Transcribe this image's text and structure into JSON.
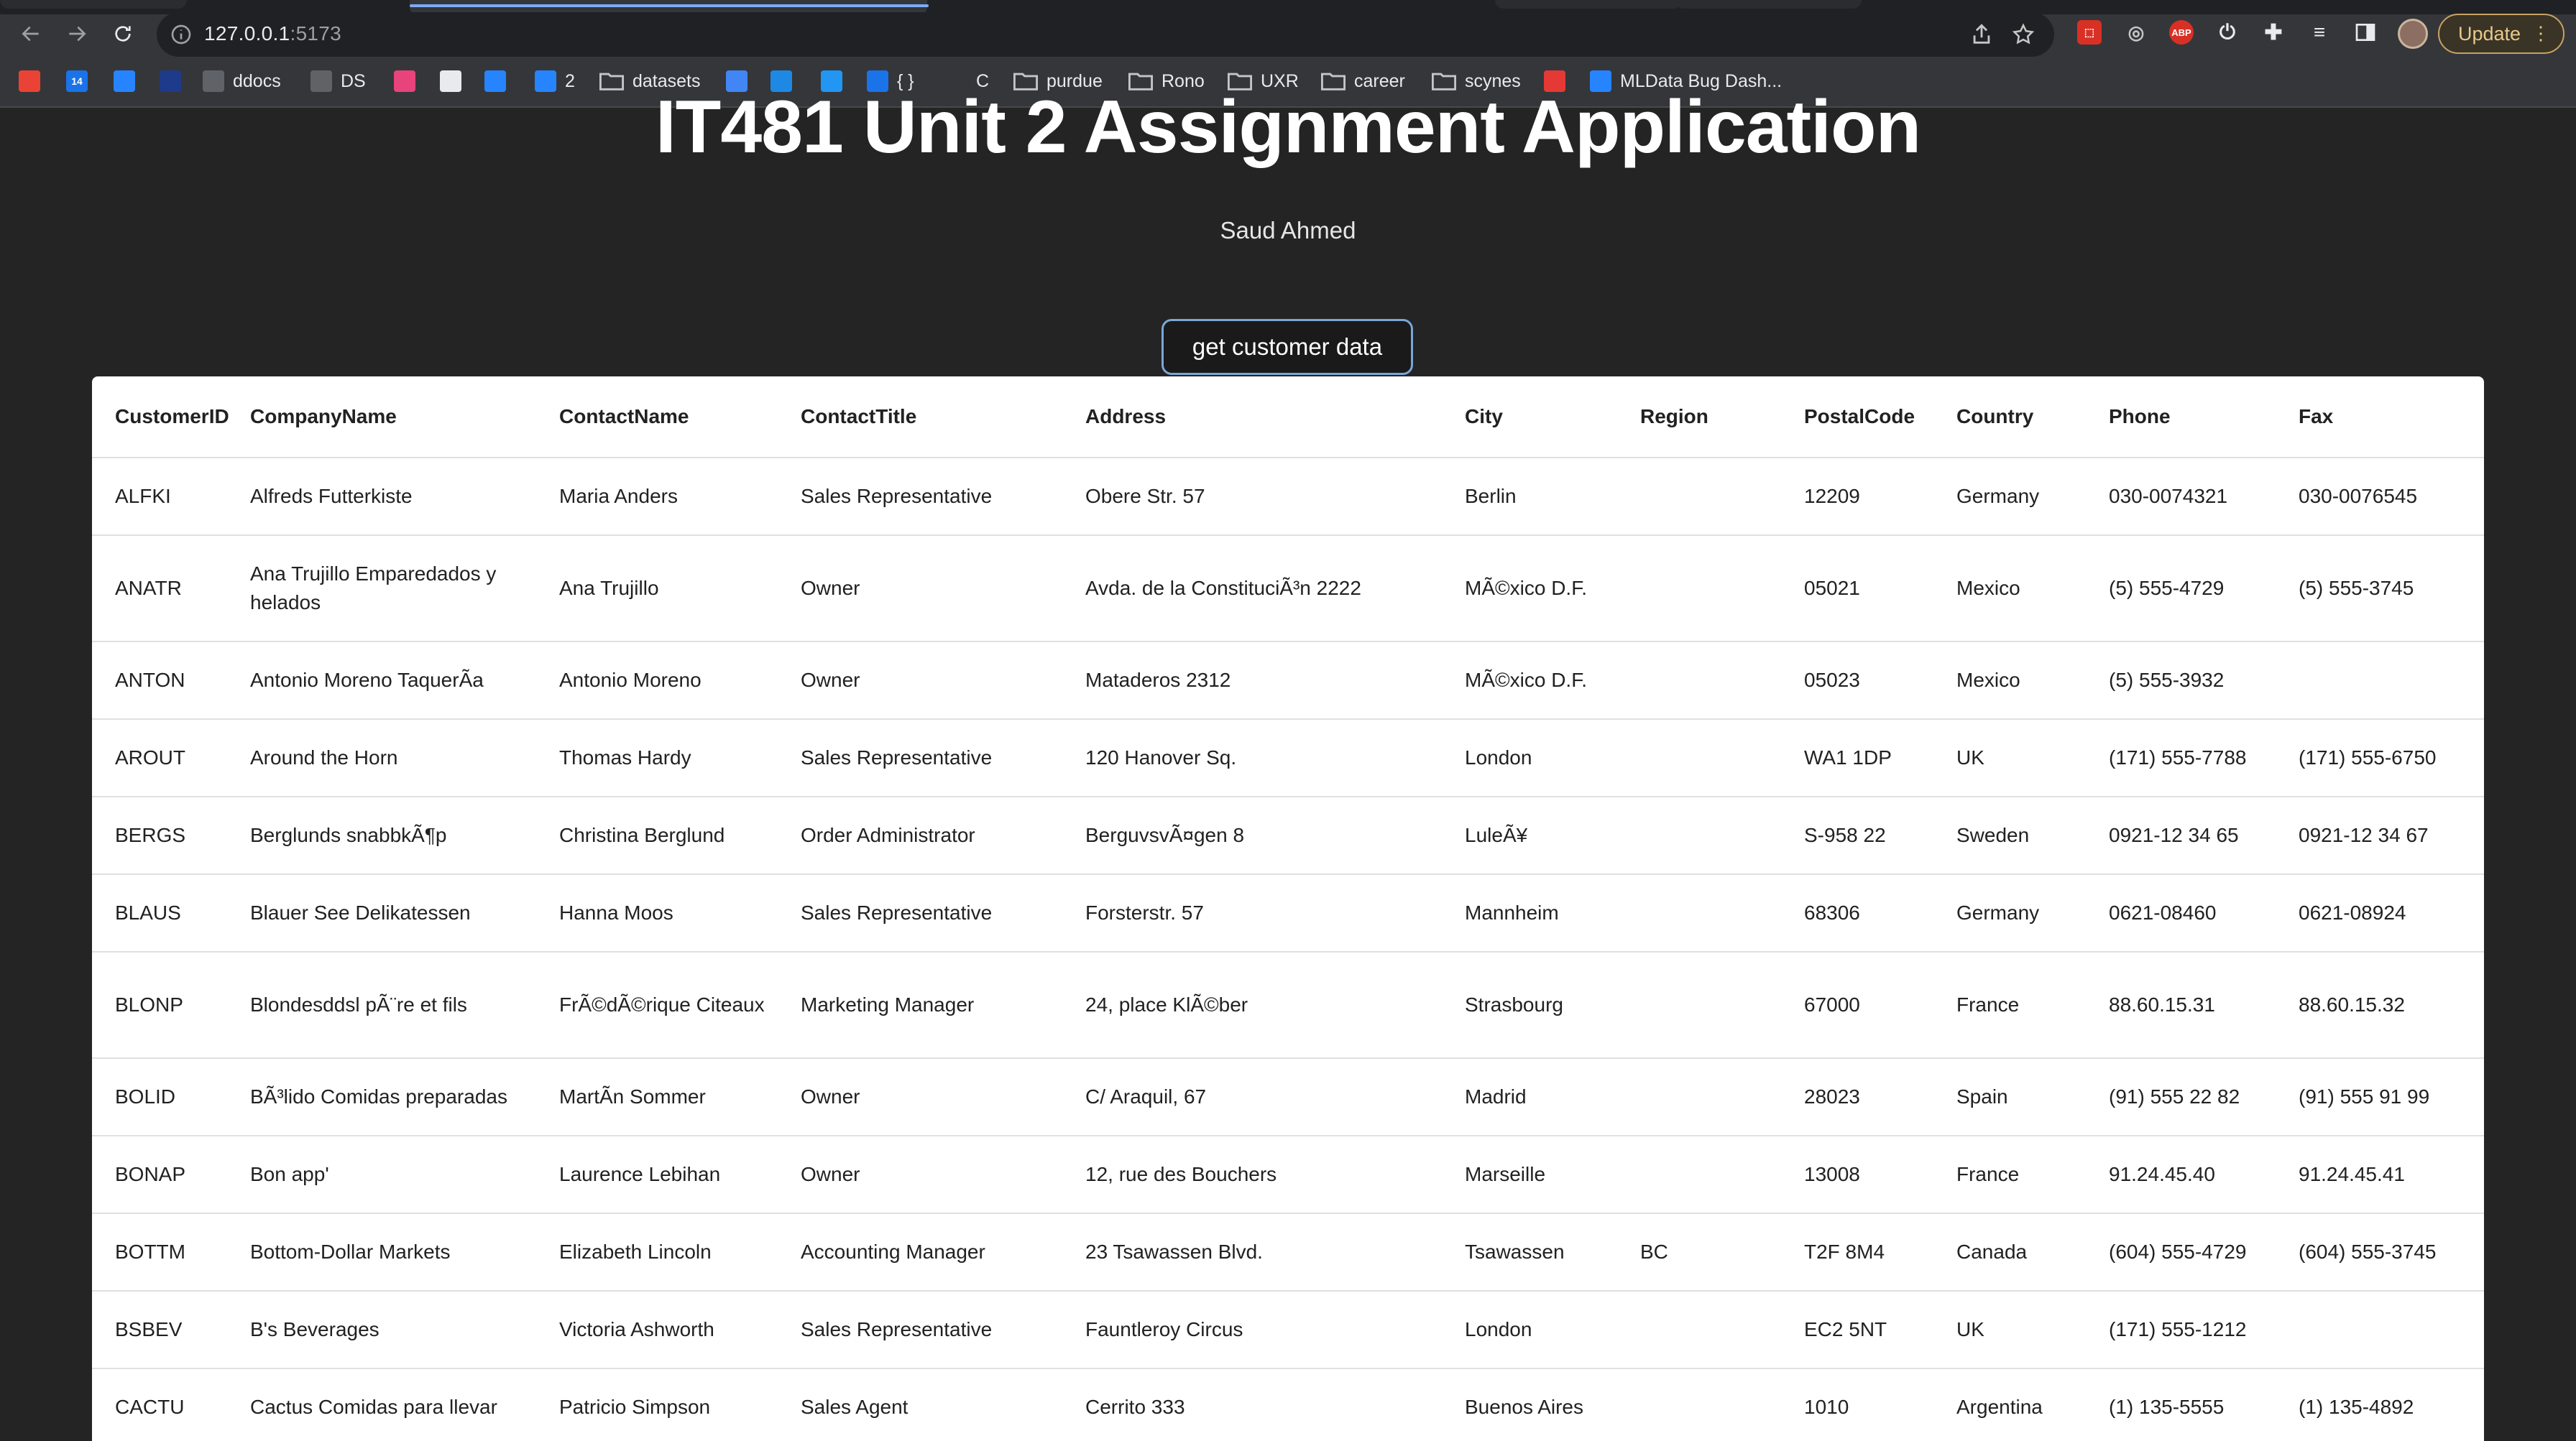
{
  "browser": {
    "url_host": "127.0.0.1",
    "url_port": ":5173",
    "update_label": "Update",
    "bookmarks": [
      {
        "label": "",
        "icon": "gmail-icon",
        "color": "#ea4335"
      },
      {
        "label": "",
        "icon": "calendar-icon",
        "color": "#1a73e8",
        "glyph": "14"
      },
      {
        "label": "",
        "icon": "atlassian-icon",
        "color": "#2684ff"
      },
      {
        "label": "",
        "icon": "circle-icon",
        "color": "#1e3a8a"
      },
      {
        "label": "ddocs",
        "icon": "drive-icon",
        "color": "#5f6368"
      },
      {
        "label": "DS",
        "icon": "drive-icon",
        "color": "#5f6368"
      },
      {
        "label": "",
        "icon": "figma-icon",
        "color": "#e8437a"
      },
      {
        "label": "",
        "icon": "github-icon",
        "color": "#e8eaed"
      },
      {
        "label": "",
        "icon": "jira-icon",
        "color": "#2684ff"
      },
      {
        "label": "2",
        "icon": "jira-icon",
        "color": "#2684ff"
      },
      {
        "label": "datasets",
        "icon": "folder-icon",
        "color": "#c4c7c5"
      },
      {
        "label": "",
        "icon": "refresh-app-icon",
        "color": "#4285f4"
      },
      {
        "label": "",
        "icon": "app-icon",
        "color": "#1e88e5"
      },
      {
        "label": "",
        "icon": "app-icon",
        "color": "#2196f3"
      },
      {
        "label": "{ }",
        "icon": "check-icon",
        "color": "#1a73e8"
      },
      {
        "label": "C",
        "icon": "",
        "color": ""
      },
      {
        "label": "purdue",
        "icon": "folder-icon",
        "color": "#c4c7c5"
      },
      {
        "label": "Rono",
        "icon": "folder-icon",
        "color": "#c4c7c5"
      },
      {
        "label": "UXR",
        "icon": "folder-icon",
        "color": "#c4c7c5"
      },
      {
        "label": "career",
        "icon": "folder-icon",
        "color": "#c4c7c5"
      },
      {
        "label": "scynes",
        "icon": "folder-icon",
        "color": "#c4c7c5"
      },
      {
        "label": "",
        "icon": "tc-icon",
        "color": "#e53935"
      },
      {
        "label": "MLData Bug Dash...",
        "icon": "jira-icon",
        "color": "#2684ff"
      }
    ]
  },
  "page": {
    "title": "IT481 Unit 2 Assignment Application",
    "author": "Saud Ahmed",
    "button_label": "get customer data"
  },
  "table": {
    "columns": [
      "CustomerID",
      "CompanyName",
      "ContactName",
      "ContactTitle",
      "Address",
      "City",
      "Region",
      "PostalCode",
      "Country",
      "Phone",
      "Fax"
    ],
    "rows": [
      [
        "ALFKI",
        "Alfreds Futterkiste",
        "Maria Anders",
        "Sales Representative",
        "Obere Str. 57",
        "Berlin",
        "",
        "12209",
        "Germany",
        "030-0074321",
        "030-0076545"
      ],
      [
        "ANATR",
        "Ana Trujillo Emparedados y helados",
        "Ana Trujillo",
        "Owner",
        "Avda. de la ConstituciÃ³n 2222",
        "MÃ©xico D.F.",
        "",
        "05021",
        "Mexico",
        "(5) 555-4729",
        "(5) 555-3745"
      ],
      [
        "ANTON",
        "Antonio Moreno TaquerÃa",
        "Antonio Moreno",
        "Owner",
        "Mataderos 2312",
        "MÃ©xico D.F.",
        "",
        "05023",
        "Mexico",
        "(5) 555-3932",
        ""
      ],
      [
        "AROUT",
        "Around the Horn",
        "Thomas Hardy",
        "Sales Representative",
        "120 Hanover Sq.",
        "London",
        "",
        "WA1 1DP",
        "UK",
        "(171) 555-7788",
        "(171) 555-6750"
      ],
      [
        "BERGS",
        "Berglunds snabbkÃ¶p",
        "Christina Berglund",
        "Order Administrator",
        "BerguvsvÃ¤gen 8",
        "LuleÃ¥",
        "",
        "S-958 22",
        "Sweden",
        "0921-12 34 65",
        "0921-12 34 67"
      ],
      [
        "BLAUS",
        "Blauer See Delikatessen",
        "Hanna Moos",
        "Sales Representative",
        "Forsterstr. 57",
        "Mannheim",
        "",
        "68306",
        "Germany",
        "0621-08460",
        "0621-08924"
      ],
      [
        "BLONP",
        "Blondesddsl pÃ¨re et fils",
        "FrÃ©dÃ©rique Citeaux",
        "Marketing Manager",
        "24, place KlÃ©ber",
        "Strasbourg",
        "",
        "67000",
        "France",
        "88.60.15.31",
        "88.60.15.32"
      ],
      [
        "BOLID",
        "BÃ³lido Comidas preparadas",
        "MartÃn Sommer",
        "Owner",
        "C/ Araquil, 67",
        "Madrid",
        "",
        "28023",
        "Spain",
        "(91) 555 22 82",
        "(91) 555 91 99"
      ],
      [
        "BONAP",
        "Bon app'",
        "Laurence Lebihan",
        "Owner",
        "12, rue des Bouchers",
        "Marseille",
        "",
        "13008",
        "France",
        "91.24.45.40",
        "91.24.45.41"
      ],
      [
        "BOTTM",
        "Bottom-Dollar Markets",
        "Elizabeth Lincoln",
        "Accounting Manager",
        "23 Tsawassen Blvd.",
        "Tsawassen",
        "BC",
        "T2F 8M4",
        "Canada",
        "(604) 555-4729",
        "(604) 555-3745"
      ],
      [
        "BSBEV",
        "B's Beverages",
        "Victoria Ashworth",
        "Sales Representative",
        "Fauntleroy Circus",
        "London",
        "",
        "EC2 5NT",
        "UK",
        "(171) 555-1212",
        ""
      ],
      [
        "CACTU",
        "Cactus Comidas para llevar",
        "Patricio Simpson",
        "Sales Agent",
        "Cerrito 333",
        "Buenos Aires",
        "",
        "1010",
        "Argentina",
        "(1) 135-5555",
        "(1) 135-4892"
      ]
    ]
  }
}
